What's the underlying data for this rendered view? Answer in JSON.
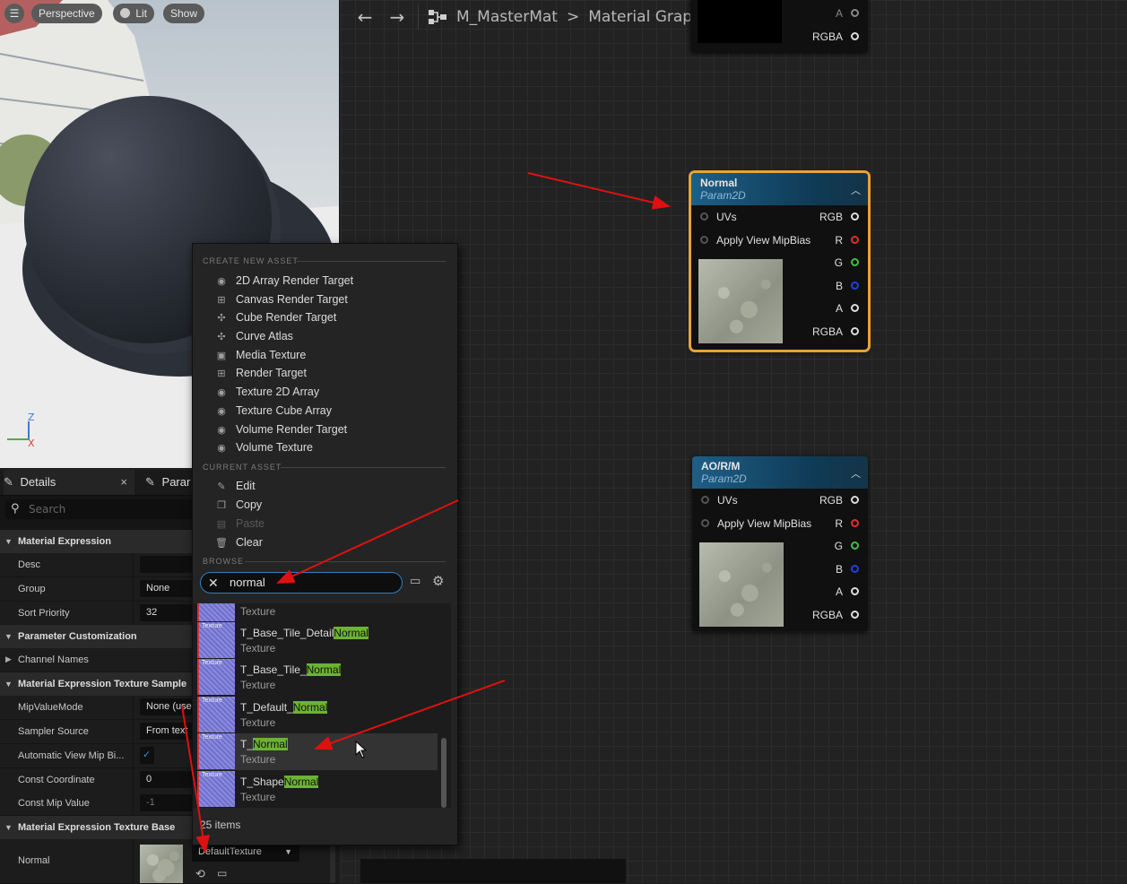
{
  "viewport": {
    "menu_label": "",
    "view_mode": "Perspective",
    "lighting": "Lit",
    "show": "Show",
    "axis_z": "Z",
    "axis_x": "X"
  },
  "toolbar": {
    "back": "←",
    "forward": "→",
    "asset_name": "M_MasterMat",
    "separator": ">",
    "graph_name": "Material Graph"
  },
  "top_node": {
    "pins": [
      "A",
      "RGBA"
    ]
  },
  "nodes": [
    {
      "title": "Normal",
      "subtitle": "Param2D",
      "inputs": [
        "UVs",
        "Apply View MipBias"
      ],
      "outputs": [
        "RGB",
        "R",
        "G",
        "B",
        "A",
        "RGBA"
      ],
      "output_colors": [
        "#dddddd",
        "#e03030",
        "#40c040",
        "#2040e0",
        "#dddddd",
        "#dddddd"
      ],
      "selected": true
    },
    {
      "title": "AO/R/M",
      "subtitle": "Param2D",
      "inputs": [
        "UVs",
        "Apply View MipBias"
      ],
      "outputs": [
        "RGB",
        "R",
        "G",
        "B",
        "A",
        "RGBA"
      ],
      "output_colors": [
        "#dddddd",
        "#e03030",
        "#40c040",
        "#2040e0",
        "#dddddd",
        "#dddddd"
      ],
      "selected": false
    }
  ],
  "details": {
    "tab_details": "Details",
    "tab_close": "×",
    "tab_params": "Parar",
    "search_placeholder": "Search",
    "categories": {
      "material_expression": "Material Expression",
      "parameter_customization": "Parameter Customization",
      "texture_sample": "Material Expression Texture Sample",
      "texture_base": "Material Expression Texture Base"
    },
    "rows": {
      "desc": {
        "label": "Desc",
        "value": ""
      },
      "group": {
        "label": "Group",
        "value": "None"
      },
      "sort_priority": {
        "label": "Sort Priority",
        "value": "32"
      },
      "channel_names": {
        "label": "Channel Names"
      },
      "mip_value_mode": {
        "label": "MipValueMode",
        "value": "None (use"
      },
      "sampler_source": {
        "label": "Sampler Source",
        "value": "From text"
      },
      "auto_view_mip": {
        "label": "Automatic View Mip Bi...",
        "value": "✓"
      },
      "const_coordinate": {
        "label": "Const Coordinate",
        "value": "0"
      },
      "const_mip_value": {
        "label": "Const Mip Value",
        "value": "-1"
      },
      "normal": {
        "label": "Normal",
        "dropdown": "DefaultTexture"
      }
    }
  },
  "menu": {
    "create_header": "CREATE NEW ASSET",
    "create_items": [
      "2D Array Render Target",
      "Canvas Render Target",
      "Cube Render Target",
      "Curve Atlas",
      "Media Texture",
      "Render Target",
      "Texture 2D Array",
      "Texture Cube Array",
      "Volume Render Target",
      "Volume Texture"
    ],
    "current_header": "CURRENT ASSET",
    "current_items": [
      "Edit",
      "Copy",
      "Paste",
      "Clear"
    ],
    "browse_header": "BROWSE",
    "search_value": "normal",
    "thumb_label": "Texture",
    "assets": [
      {
        "prefix": "",
        "match": "",
        "suffix": "",
        "type": "Texture"
      },
      {
        "prefix": "T_Base_Tile_Detail",
        "match": "Normal",
        "suffix": "",
        "type": "Texture"
      },
      {
        "prefix": "T_Base_Tile_",
        "match": "Normal",
        "suffix": "",
        "type": "Texture"
      },
      {
        "prefix": "T_Default_",
        "match": "Normal",
        "suffix": "",
        "type": "Texture"
      },
      {
        "prefix": "T_",
        "match": "Normal",
        "suffix": "",
        "type": "Texture"
      },
      {
        "prefix": "T_Shape",
        "match": "Normal",
        "suffix": "",
        "type": "Texture"
      }
    ],
    "item_count": "25 items"
  },
  "colors": {
    "accent_selected": "#e8a23a",
    "node_header": "#1e5e86",
    "highlight": "#6db332",
    "annotation_arrow": "#e01010"
  }
}
